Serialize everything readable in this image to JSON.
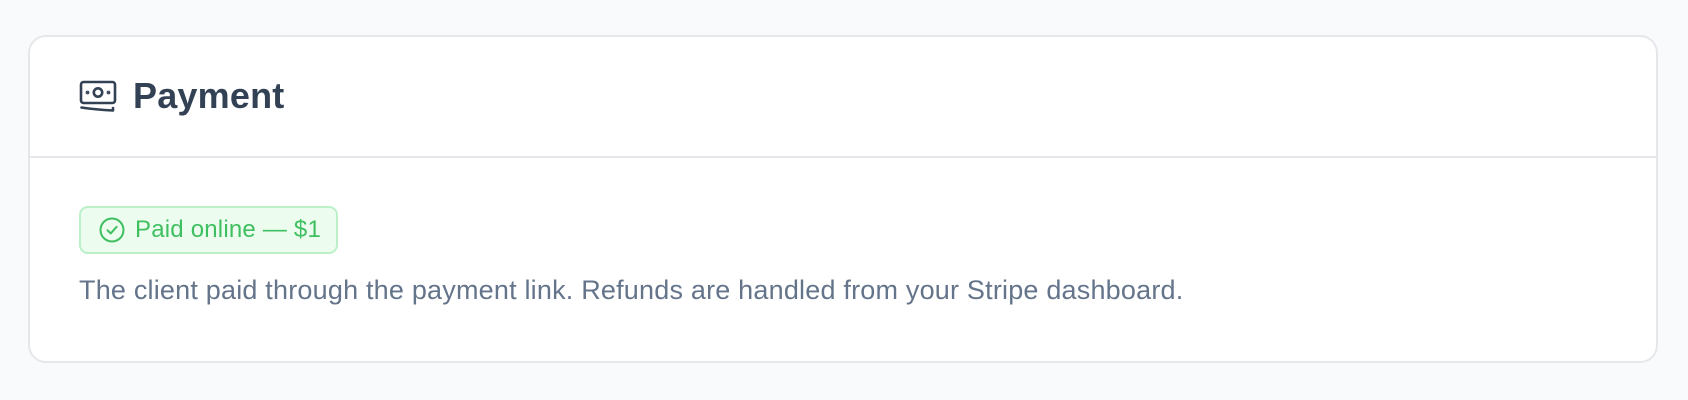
{
  "payment_card": {
    "icon": "money-bill-icon",
    "title": "Payment",
    "status": {
      "icon": "check-circle-icon",
      "label": "Paid online — $1",
      "color": "#3fbf5f"
    },
    "description": "The client paid through the payment link. Refunds are handled from your Stripe dashboard."
  }
}
